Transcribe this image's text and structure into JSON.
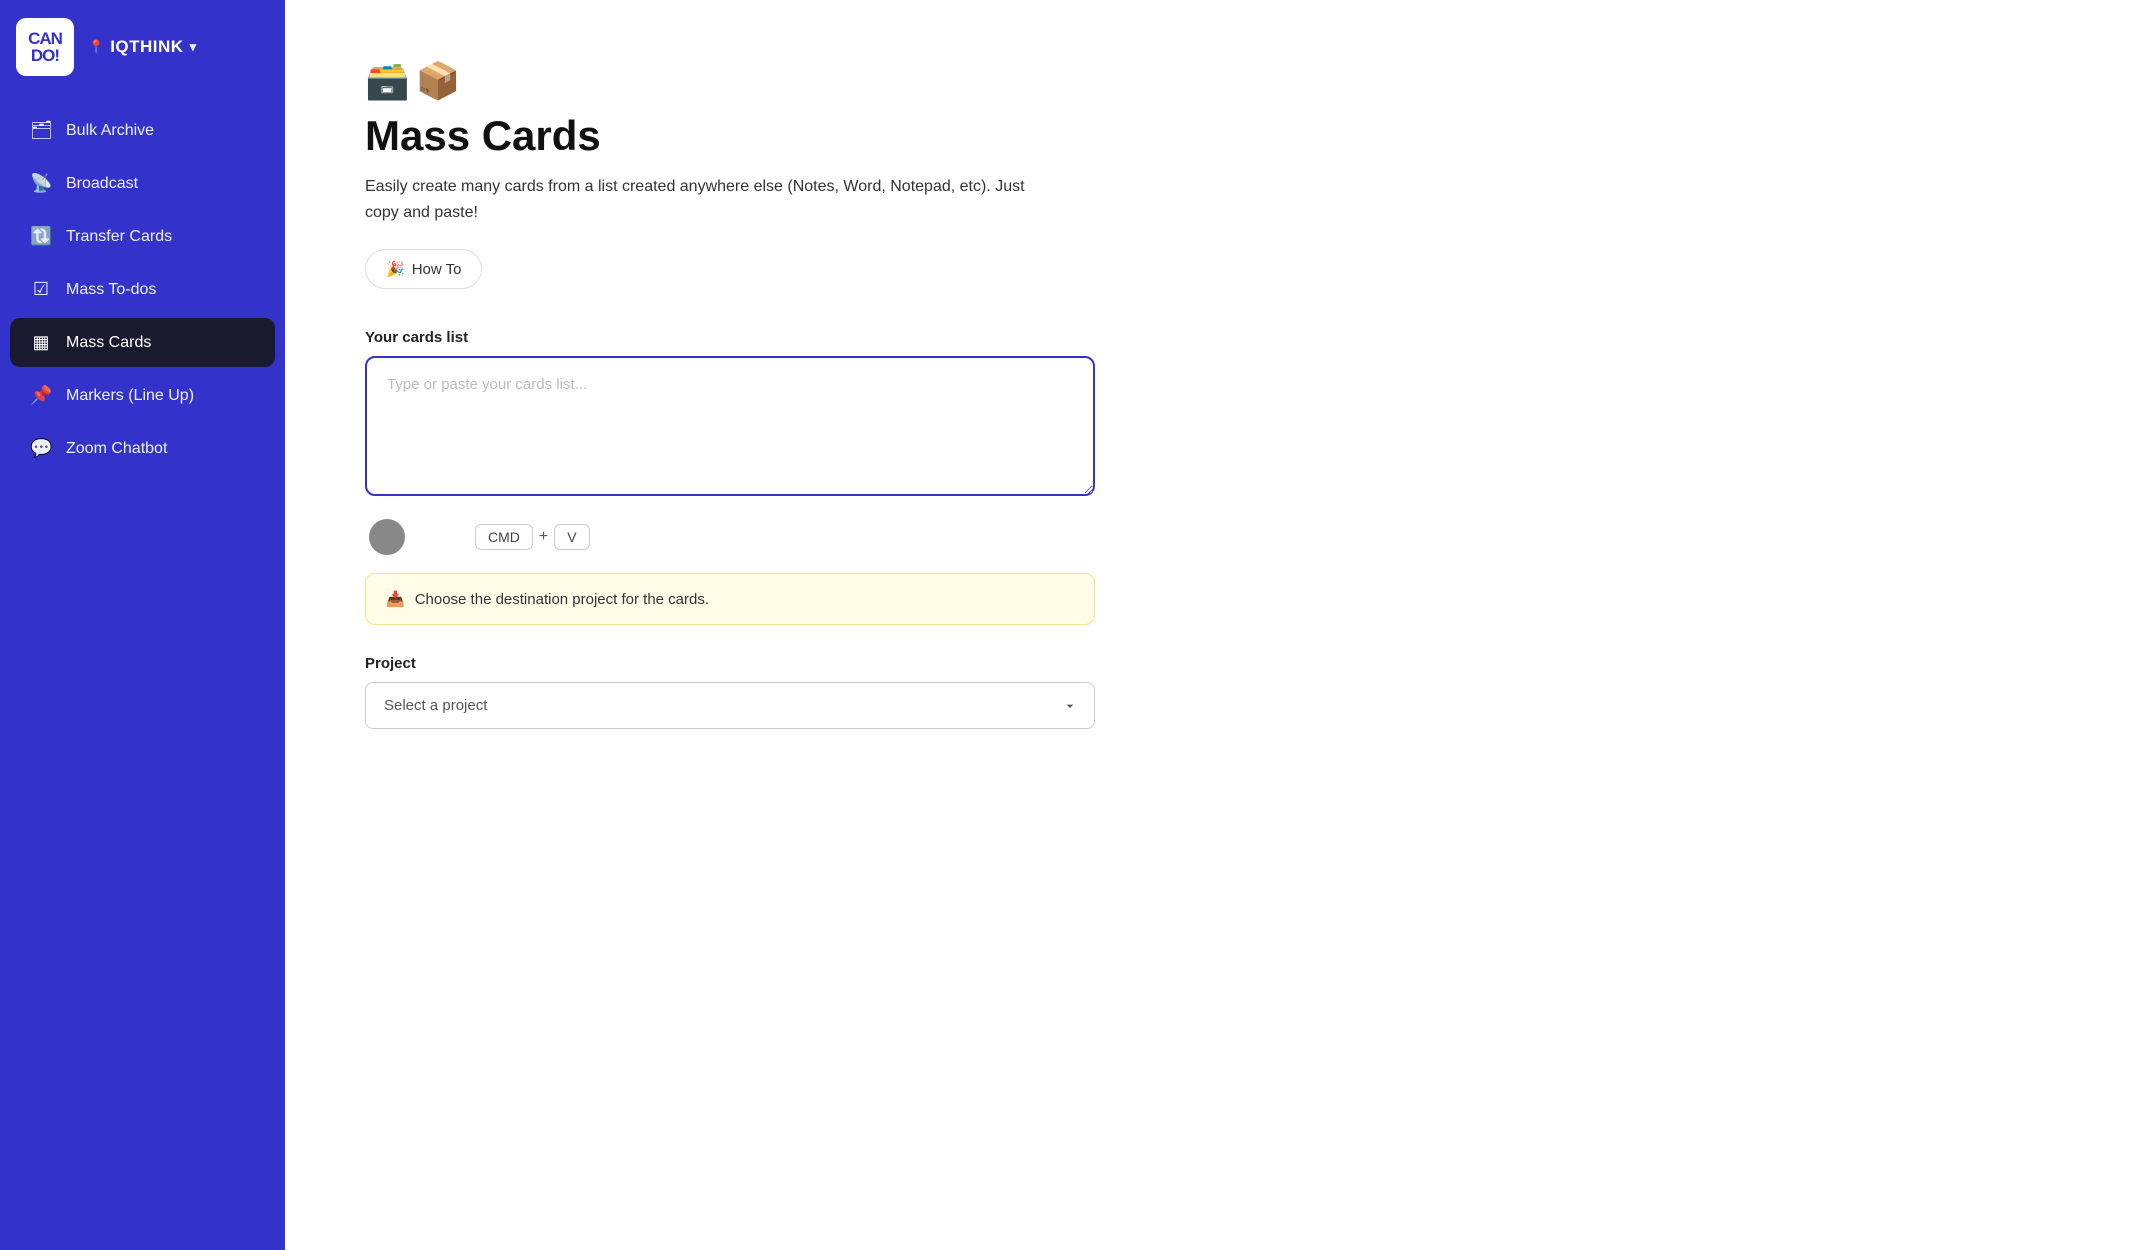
{
  "sidebar": {
    "logo_text": "CAN\nDO!",
    "brand": "IQTHINK",
    "chevron": "▾",
    "location_dot": "📍",
    "items": [
      {
        "id": "bulk-archive",
        "label": "Bulk Archive",
        "icon": "🗂",
        "active": false
      },
      {
        "id": "broadcast",
        "label": "Broadcast",
        "icon": "📡",
        "active": false
      },
      {
        "id": "transfer-cards",
        "label": "Transfer Cards",
        "icon": "🔃",
        "active": false
      },
      {
        "id": "mass-todos",
        "label": "Mass To-dos",
        "icon": "☑",
        "active": false
      },
      {
        "id": "mass-cards",
        "label": "Mass Cards",
        "icon": "▦",
        "active": true
      },
      {
        "id": "markers",
        "label": "Markers (Line Up)",
        "icon": "📌",
        "active": false
      },
      {
        "id": "zoom-chatbot",
        "label": "Zoom Chatbot",
        "icon": "💬",
        "active": false
      }
    ]
  },
  "main": {
    "page_icon1": "🗃️",
    "page_icon2": "📦",
    "title": "Mass Cards",
    "description": "Easily create many cards from a list created anywhere else (Notes, Word, Notepad, etc). Just copy and paste!",
    "how_to_label": "How To",
    "how_to_emoji": "🎉",
    "cards_list_label": "Your cards list",
    "cards_placeholder": "Type or paste your cards list...",
    "shortcut_cmd": "CMD",
    "shortcut_plus": "+",
    "shortcut_v": "V",
    "info_emoji": "📥",
    "info_text": "Choose the destination project for the cards.",
    "project_label": "Project",
    "project_placeholder": "Select a project"
  }
}
